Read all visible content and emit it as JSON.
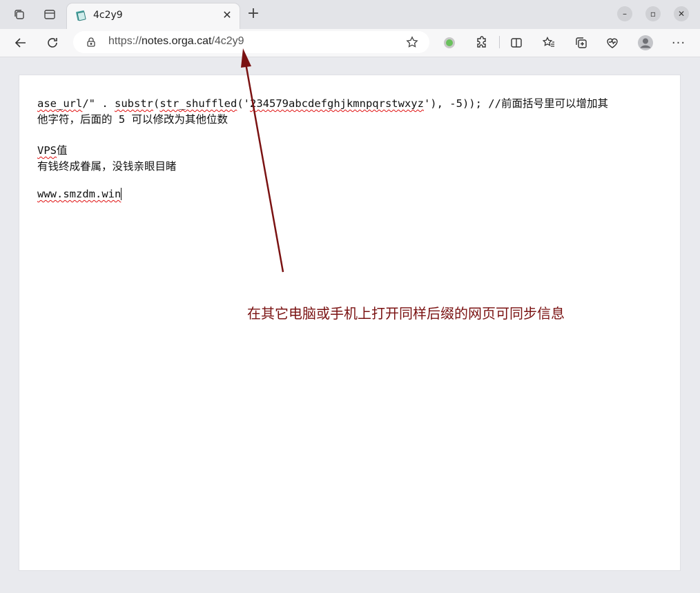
{
  "tab": {
    "title": "4c2y9",
    "close_icon": "close-icon"
  },
  "address": {
    "scheme": "https://",
    "host": "notes.orga.cat",
    "path": "/4c2y9"
  },
  "note": {
    "line1_a": "ase_url",
    "line1_b": "/\" . ",
    "line1_c": "substr",
    "line1_d": "(",
    "line1_e": "str_shuffled",
    "line1_f": "('",
    "line1_g": "234579abcdefghjkmnpqrstwxyz",
    "line1_h": "'), -5)); //前面括号里可以增加其",
    "line2": "他字符，后面的 5 可以修改为其他位数",
    "vps_a": "VPS",
    "vps_b": "值",
    "line4": "有钱终成眷属，没钱亲眼目睹",
    "line5": "www.smzdm.win"
  },
  "annotation": {
    "text": "在其它电脑或手机上打开同样后缀的网页可同步信息",
    "color": "#7a1212"
  },
  "colors": {
    "spellcheck": "#e01010",
    "arrow": "#7a1212"
  }
}
